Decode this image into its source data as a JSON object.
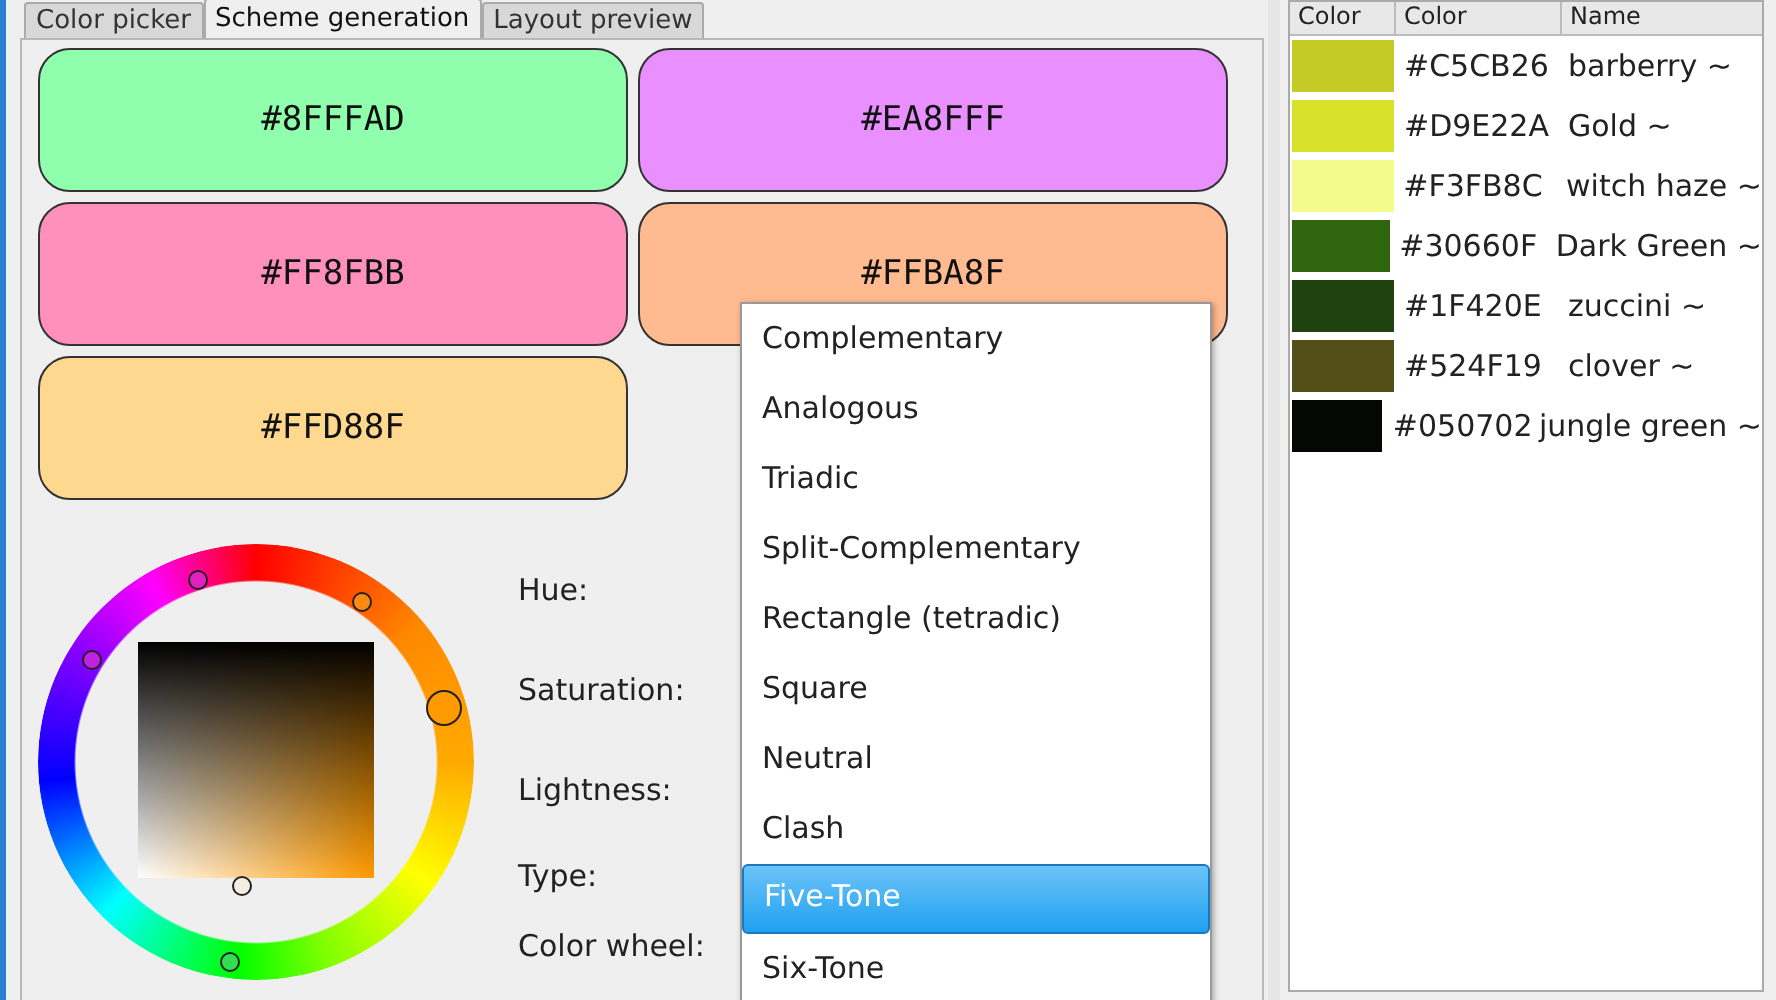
{
  "tabs": [
    {
      "label": "Color picker",
      "selected": false
    },
    {
      "label": "Scheme generation",
      "selected": true
    },
    {
      "label": "Layout preview",
      "selected": false
    }
  ],
  "swatches": [
    {
      "label": "#8FFFAD",
      "color": "#8fffad"
    },
    {
      "label": "#EA8FFF",
      "color": "#ea8fff"
    },
    {
      "label": "#FF8FBB",
      "color": "#ff8fbb"
    },
    {
      "label": "#FFBA8F",
      "color": "#ffba8f"
    },
    {
      "label": "#FFD88F",
      "color": "#ffd88f"
    }
  ],
  "form_labels": [
    "Hue:",
    "Saturation:",
    "Lightness:",
    "Type:",
    "Color wheel:"
  ],
  "type_dropdown": {
    "options": [
      {
        "label": "Complementary",
        "selected": false
      },
      {
        "label": "Analogous",
        "selected": false
      },
      {
        "label": "Triadic",
        "selected": false
      },
      {
        "label": "Split-Complementary",
        "selected": false
      },
      {
        "label": "Rectangle (tetradic)",
        "selected": false
      },
      {
        "label": "Square",
        "selected": false
      },
      {
        "label": "Neutral",
        "selected": false
      },
      {
        "label": "Clash",
        "selected": false
      },
      {
        "label": "Five-Tone",
        "selected": true
      },
      {
        "label": "Six-Tone",
        "selected": false
      }
    ]
  },
  "palette_table": {
    "columns": [
      "Color",
      "Color",
      "Name"
    ],
    "rows": [
      {
        "hex": "#C5CB26",
        "name": "barberry ~",
        "color": "#c5cb26"
      },
      {
        "hex": "#D9E22A",
        "name": "Gold ~",
        "color": "#d9e22a"
      },
      {
        "hex": "#F3FB8C",
        "name": "witch haze ~",
        "color": "#f3fb8c"
      },
      {
        "hex": "#30660F",
        "name": "Dark Green ~",
        "color": "#30660f"
      },
      {
        "hex": "#1F420E",
        "name": "zuccini ~",
        "color": "#1f420e"
      },
      {
        "hex": "#524F19",
        "name": "clover ~",
        "color": "#524f19"
      },
      {
        "hex": "#050702",
        "name": "jungle green ~",
        "color": "#050702"
      }
    ]
  }
}
